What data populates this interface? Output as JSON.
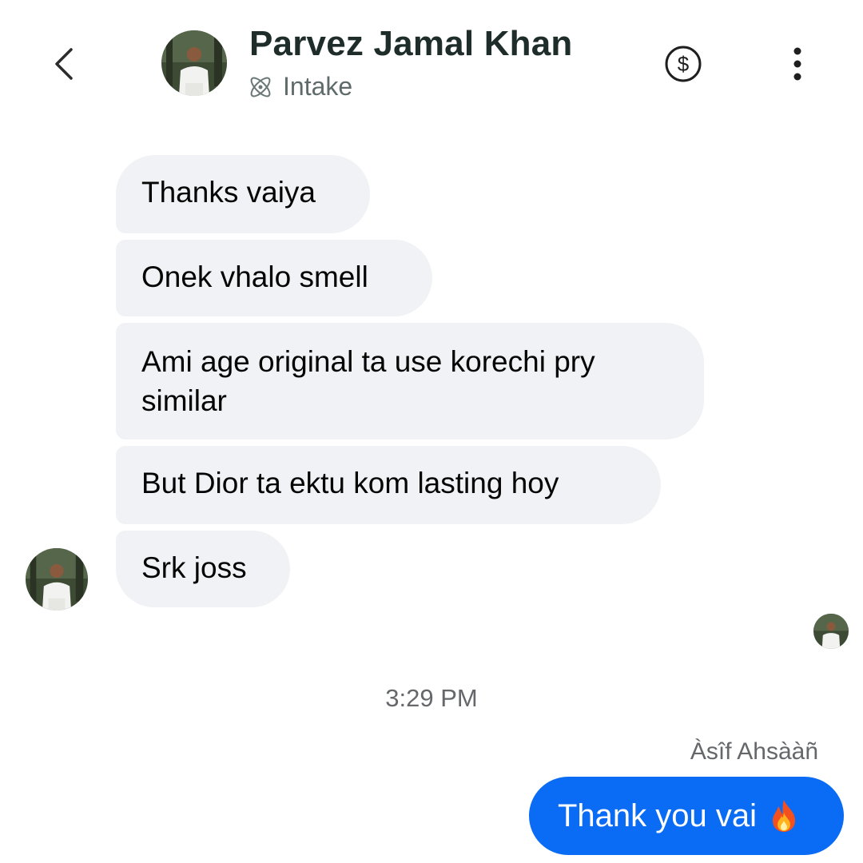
{
  "header": {
    "contact_name": "Parvez Jamal Khan",
    "label_icon": "atom-icon",
    "label": "Intake",
    "actions": [
      "back-icon",
      "dollar-circle-icon",
      "more-vertical-icon"
    ]
  },
  "messages": [
    {
      "direction": "incoming",
      "text": "Thanks vaiya"
    },
    {
      "direction": "incoming",
      "text": "Onek vhalo smell"
    },
    {
      "direction": "incoming",
      "text": "Ami age original ta use korechi pry similar"
    },
    {
      "direction": "incoming",
      "text": "But Dior ta ektu kom lasting hoy"
    },
    {
      "direction": "incoming",
      "text": "Srk joss"
    }
  ],
  "timestamp": "3:29 PM",
  "outgoing": {
    "sender": "Àsîf Ahsààñ",
    "text": "Thank you vai",
    "emoji_icon": "fire-icon"
  },
  "colors": {
    "incoming_bubble": "#f0f2f5",
    "outgoing_bubble": "#0a6cf5",
    "title": "#1f2d2a"
  }
}
